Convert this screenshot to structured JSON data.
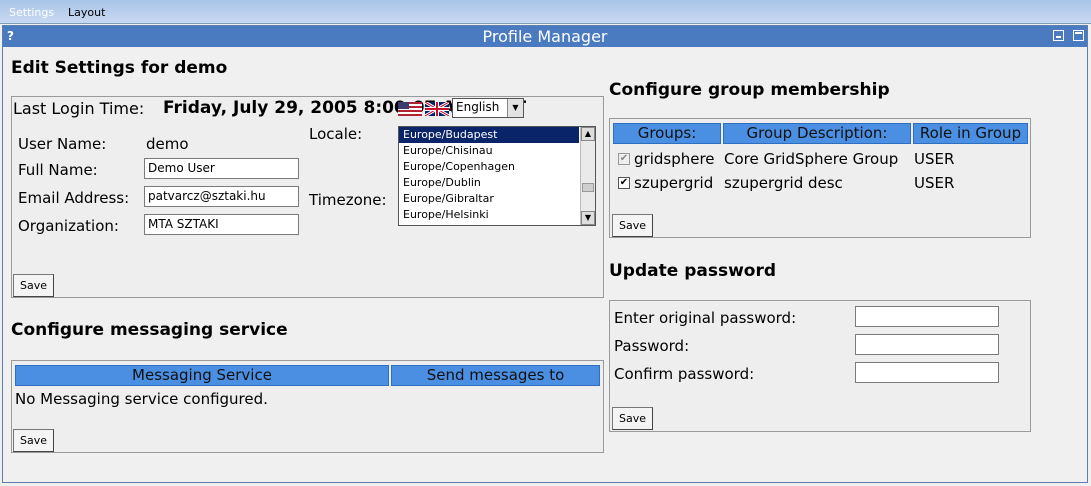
{
  "menu": {
    "settings": "Settings",
    "layout": "Layout"
  },
  "window": {
    "help": "?",
    "title": "Profile Manager"
  },
  "edit": {
    "heading": "Edit Settings for  demo",
    "last_login_label": "Last Login Time:",
    "last_login_value": "Friday, July 29, 2005 8:00:07 AM CEST",
    "username_label": "User Name:",
    "username_value": "demo",
    "fullname_label": "Full Name:",
    "fullname_value": "Demo User",
    "email_label": "Email Address:",
    "email_value": "patvarcz@sztaki.hu",
    "org_label": "Organization:",
    "org_value": "MTA SZTAKI",
    "locale_label": "Locale:",
    "locale_value": "English",
    "timezone_label": "Timezone:",
    "timezones": [
      "Europe/Budapest",
      "Europe/Chisinau",
      "Europe/Copenhagen",
      "Europe/Dublin",
      "Europe/Gibraltar",
      "Europe/Helsinki"
    ],
    "save": "Save"
  },
  "messaging": {
    "heading": "Configure messaging service",
    "col_service": "Messaging Service",
    "col_send": "Send messages to",
    "empty": "No Messaging service configured.",
    "save": "Save"
  },
  "groups": {
    "heading": "Configure group membership",
    "col_groups": "Groups:",
    "col_desc": "Group Description:",
    "col_role": "Role in Group",
    "rows": [
      {
        "name": "gridsphere",
        "desc": "Core GridSphere Group",
        "role": "USER"
      },
      {
        "name": "szupergrid",
        "desc": "szupergrid desc",
        "role": "USER"
      }
    ],
    "save": "Save"
  },
  "password": {
    "heading": "Update password",
    "original_label": "Enter original password:",
    "password_label": "Password:",
    "confirm_label": "Confirm password:",
    "save": "Save"
  }
}
